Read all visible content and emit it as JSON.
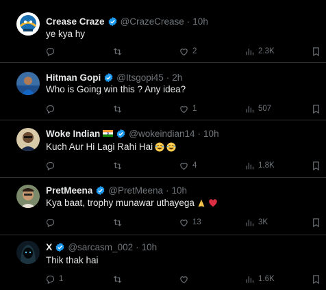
{
  "posts": [
    {
      "name": "Crease Craze",
      "handle": "@CrazeCrease",
      "time": "10h",
      "text": "ye kya hy",
      "replies": "",
      "retweets": "",
      "likes": "2",
      "views": "2.3K",
      "avatar": "cricket-logo"
    },
    {
      "name": "Hitman Gopi",
      "handle": "@Itsgopi45",
      "time": "2h",
      "text": "Who is Going win this ? Any idea?",
      "replies": "",
      "retweets": "",
      "likes": "1",
      "views": "507",
      "avatar": "player-photo"
    },
    {
      "name": "Woke Indian",
      "handle": "@wokeindian14",
      "time": "10h",
      "text": "Kuch Aur Hi Lagi Rahi Hai",
      "replies": "",
      "retweets": "",
      "likes": "4",
      "views": "1.8K",
      "avatar": "portrait",
      "flag": "india-flag"
    },
    {
      "name": "PretMeena",
      "handle": "@PretMeena",
      "time": "10h",
      "text": "Kya baat, trophy munawar uthayega",
      "replies": "",
      "retweets": "",
      "likes": "13",
      "views": "3K",
      "avatar": "selfie-photo"
    },
    {
      "name": "X",
      "handle": "@sarcasm_002",
      "time": "10h",
      "text": "Thik thak hai",
      "replies": "1",
      "retweets": "",
      "likes": "",
      "views": "1.6K",
      "avatar": "hooded-figure"
    }
  ],
  "colors": {
    "background": "#000000",
    "text": "#e7e9ea",
    "muted": "#71767b",
    "divider": "#2f3336",
    "verified": "#1d9bf0"
  },
  "icons": [
    "reply-icon",
    "retweet-icon",
    "like-icon",
    "views-icon",
    "bookmark-icon",
    "verified-badge-icon"
  ]
}
